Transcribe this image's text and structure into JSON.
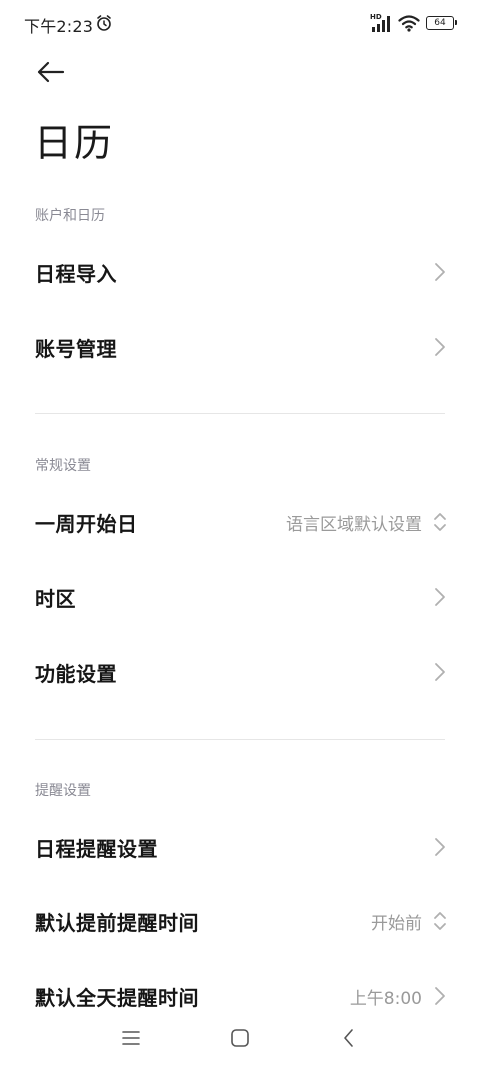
{
  "status_bar": {
    "time": "下午2:23",
    "hd_label": "HD",
    "battery_level": "64"
  },
  "header": {
    "title": "日历"
  },
  "sections": [
    {
      "header": "账户和日历",
      "items": [
        {
          "label": "日程导入",
          "value": "",
          "control": "chevron"
        },
        {
          "label": "账号管理",
          "value": "",
          "control": "chevron"
        }
      ]
    },
    {
      "header": "常规设置",
      "items": [
        {
          "label": "一周开始日",
          "value": "语言区域默认设置",
          "control": "updown"
        },
        {
          "label": "时区",
          "value": "",
          "control": "chevron"
        },
        {
          "label": "功能设置",
          "value": "",
          "control": "chevron"
        }
      ]
    },
    {
      "header": "提醒设置",
      "items": [
        {
          "label": "日程提醒设置",
          "value": "",
          "control": "chevron"
        },
        {
          "label": "默认提前提醒时间",
          "value": "开始前",
          "control": "updown"
        },
        {
          "label": "默认全天提醒时间",
          "value": "上午8:00",
          "control": "chevron"
        }
      ]
    }
  ],
  "icons": {
    "back": "arrow-left-icon",
    "chevron": "chevron-right-icon",
    "updown": "unfold-icon",
    "nav_menu": "menu-icon",
    "nav_home": "home-icon",
    "nav_back": "back-icon"
  },
  "colors": {
    "background": "#ffffff",
    "label": "#161616",
    "secondary": "#9a9a9a",
    "section_header": "#8a8a94",
    "divider": "#e6e6e6"
  }
}
